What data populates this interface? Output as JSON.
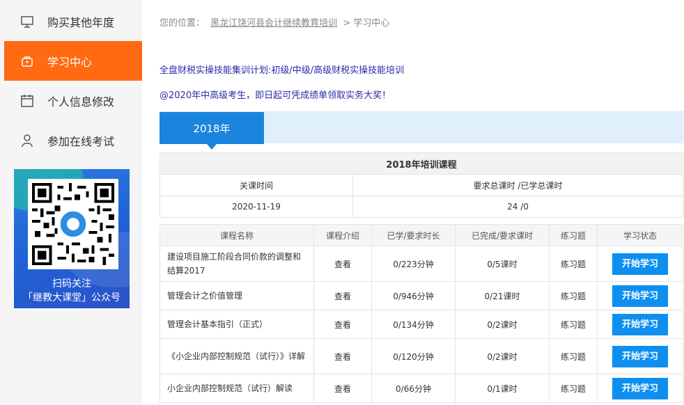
{
  "sidebar": {
    "items": [
      {
        "label": "购买其他年度",
        "icon": "monitor-icon"
      },
      {
        "label": "学习中心",
        "icon": "bag-icon"
      },
      {
        "label": "个人信息修改",
        "icon": "calendar-icon"
      },
      {
        "label": "参加在线考试",
        "icon": "user-icon"
      }
    ],
    "qr": {
      "line1": "扫码关注",
      "line2": "「继教大课堂」公众号"
    }
  },
  "breadcrumb": {
    "prefix": "您的位置：",
    "link": "黑龙江饶河县会计继续教育培训",
    "sep": ">",
    "current": "学习中心"
  },
  "notices": [
    "全盘财税实操技能集训计划:初级/中级/高级财税实操技能培训",
    "@2020年中高级考生，即日起可凭成绩单领取实务大奖！"
  ],
  "year_tab": "2018年",
  "summary": {
    "caption": "2018年培训课程",
    "headers": [
      "关课时间",
      "要求总课时 /已学总课时"
    ],
    "values": [
      "2020-11-19",
      "24 /0"
    ]
  },
  "courses": {
    "headers": [
      "课程名称",
      "课程介绍",
      "已学/要求时长",
      "已完成/要求课时",
      "练习题",
      "学习状态"
    ],
    "rows": [
      {
        "name": "建设项目施工阶段合同价款的调整和结算2017",
        "intro": "查看",
        "duration": "0/223分钟",
        "lessons": "0/5课时",
        "exercise": "练习题",
        "action": "开始学习"
      },
      {
        "name": "管理会计之价值管理",
        "intro": "查看",
        "duration": "0/946分钟",
        "lessons": "0/21课时",
        "exercise": "练习题",
        "action": "开始学习"
      },
      {
        "name": "管理会计基本指引（正式）",
        "intro": "查看",
        "duration": "0/134分钟",
        "lessons": "0/2课时",
        "exercise": "练习题",
        "action": "开始学习"
      },
      {
        "name": "《小企业内部控制规范（试行）》详解",
        "intro": "查看",
        "duration": "0/120分钟",
        "lessons": "0/2课时",
        "exercise": "练习题",
        "action": "开始学习"
      },
      {
        "name": "小企业内部控制规范（试行）解读",
        "intro": "查看",
        "duration": "0/66分钟",
        "lessons": "0/1课时",
        "exercise": "练习题",
        "action": "开始学习"
      }
    ]
  },
  "colors": {
    "accent": "#ff6a12",
    "blue": "#1b84dd",
    "button": "#0e8ff0"
  }
}
